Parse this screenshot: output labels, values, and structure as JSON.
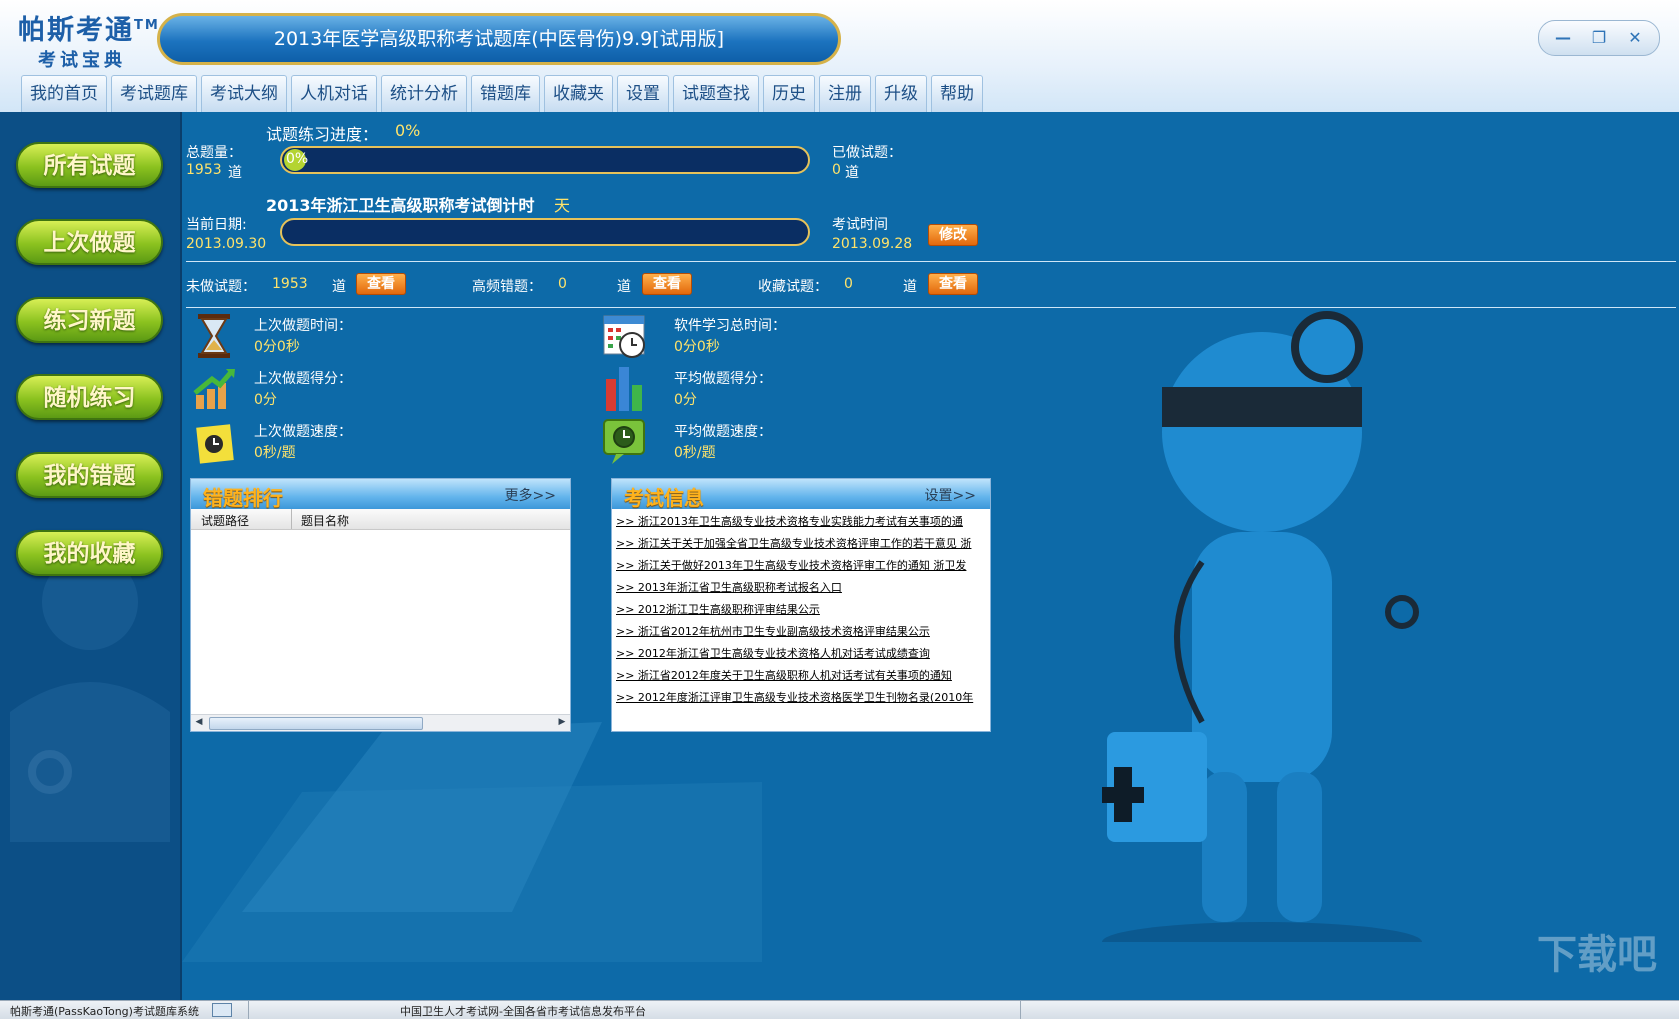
{
  "app": {
    "logo_main": "帕斯考通",
    "logo_tm": "TM",
    "logo_sub": "考试宝典",
    "window_title": "2013年医学高级职称考试题库(中医骨伤)9.9[试用版]"
  },
  "window_controls": {
    "minimize": "—",
    "restore": "❐",
    "close": "✕"
  },
  "tabs": [
    "我的首页",
    "考试题库",
    "考试大纲",
    "人机对话",
    "统计分析",
    "错题库",
    "收藏夹",
    "设置",
    "试题查找",
    "历史",
    "注册",
    "升级",
    "帮助"
  ],
  "sidebar": [
    "所有试题",
    "上次做题",
    "练习新题",
    "随机练习",
    "我的错题",
    "我的收藏"
  ],
  "progress": {
    "label": "试题练习进度：",
    "percent_text": "0%",
    "bar_text": "0%",
    "fill": 0.0
  },
  "total": {
    "label": "总题量：",
    "count": "1953",
    "unit": "道"
  },
  "done": {
    "label": "已做试题：",
    "count": "0",
    "unit": "道"
  },
  "countdown": {
    "label": "2013年浙江卫生高级职称考试倒计时",
    "unit": "天"
  },
  "current_date": {
    "label": "当前日期:",
    "value": "2013.09.30"
  },
  "exam_time": {
    "label": "考试时间",
    "value": "2013.09.28",
    "edit_btn": "修改"
  },
  "counters": [
    {
      "label": "未做试题：",
      "count": "1953",
      "unit": "道",
      "btn": "查看"
    },
    {
      "label": "高频错题：",
      "count": "0",
      "unit": "道",
      "btn": "查看"
    },
    {
      "label": "收藏试题：",
      "count": "0",
      "unit": "道",
      "btn": "查看"
    }
  ],
  "stats": [
    {
      "label": "上次做题时间：",
      "value": "0分0秒",
      "icon": "hourglass-icon"
    },
    {
      "label": "软件学习总时间：",
      "value": "0分0秒",
      "icon": "calendar-clock-icon"
    },
    {
      "label": "上次做题得分：",
      "value": "0分",
      "icon": "growth-chart-icon"
    },
    {
      "label": "平均做题得分：",
      "value": "0分",
      "icon": "bar-chart-icon"
    },
    {
      "label": "上次做题速度：",
      "value": "0秒/题",
      "icon": "note-clock-icon"
    },
    {
      "label": "平均做题速度：",
      "value": "0秒/题",
      "icon": "clock-bubble-icon"
    }
  ],
  "wrong_panel": {
    "title": "错题排行",
    "more": "更多>>",
    "col1": "试题路径",
    "col2": "题目名称"
  },
  "info_panel": {
    "title": "考试信息",
    "more": "设置>>",
    "items": [
      ">> 浙江2013年卫生高级专业技术资格专业实践能力考试有关事项的通",
      ">> 浙江关于关于加强全省卫生高级专业技术资格评审工作的若干意见 浙",
      ">> 浙江关于做好2013年卫生高级专业技术资格评审工作的通知 浙卫发",
      ">> 2013年浙江省卫生高级职称考试报名入口",
      ">> 2012浙江卫生高级职称评审结果公示",
      ">> 浙江省2012年杭州市卫生专业副高级技术资格评审结果公示",
      ">> 2012年浙江省卫生高级专业技术资格人机对话考试成绩查询",
      ">> 浙江省2012年度关于卫生高级职称人机对话考试有关事项的通知",
      ">> 2012年度浙江评审卫生高级专业技术资格医学卫生刊物名录(2010年"
    ]
  },
  "statusbar": {
    "left": "帕斯考通(PassKaoTong)考试题库系统",
    "center": "中国卫生人才考试网-全国各省市考试信息发布平台"
  },
  "watermark": "下载吧",
  "colors": {
    "main_bg": "#0d6aa8",
    "sidebar_bg": "#0c4f86",
    "accent_gold": "#e6c25a",
    "value_yellow": "#ffe36b"
  }
}
